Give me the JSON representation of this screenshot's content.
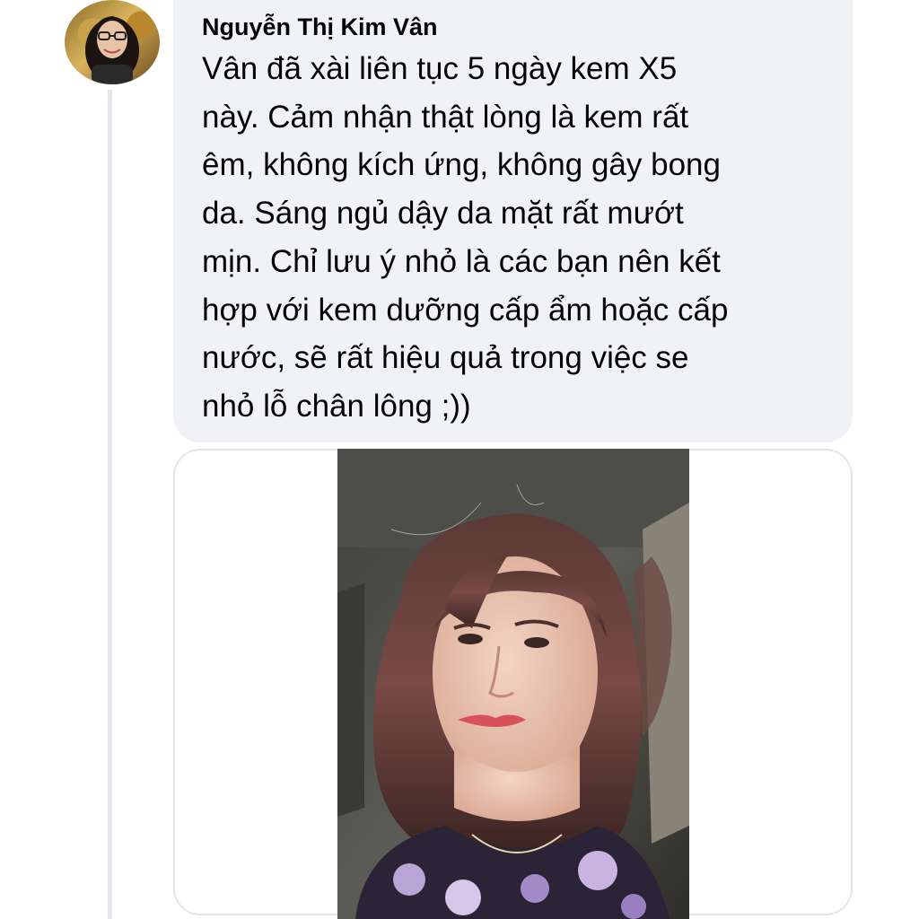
{
  "comment": {
    "author_name": "Nguyễn Thị Kim Vân",
    "text_lines": [
      "Vân đã xài liên tục 5 ngày kem  X5",
      "này. Cảm nhận thật lòng là kem rất",
      "êm, không kích ứng, không gây bong",
      "da. Sáng ngủ dậy da mặt rất mướt",
      "mịn. Chỉ lưu ý nhỏ là các bạn nên kết",
      "hợp với kem dưỡng cấp ẩm hoặc cấp",
      "nước, sẽ rất hiệu quả trong việc se",
      "nhỏ lỗ chân lông ;))"
    ],
    "avatar_icon": "profile-photo",
    "attachment_icon": "selfie-photo"
  },
  "colors": {
    "bubble_bg": "#f0f2f5",
    "text": "#050505",
    "thread_line": "#e4e6eb"
  }
}
